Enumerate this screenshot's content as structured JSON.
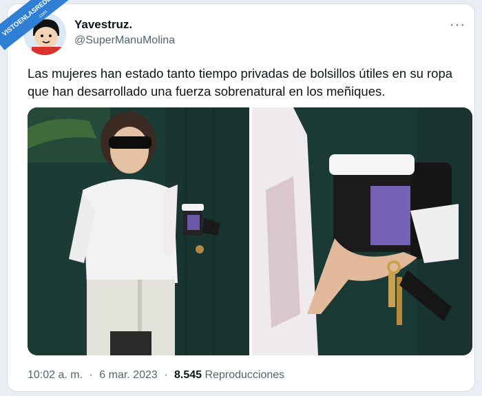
{
  "watermark": {
    "line1": "VISTOENLASREDES",
    "line2": ".com"
  },
  "author": {
    "name": "Yavestruz.",
    "handle": "@SuperManuMolina"
  },
  "menu": {
    "more_label": "···"
  },
  "tweet": {
    "text": "Las mujeres han estado tanto tiempo privadas de bolsillos útiles en su ropa que han desarrollado una fuerza sobrenatural en los meñiques."
  },
  "meta": {
    "time": "10:02 a. m.",
    "separator": "·",
    "date": "6 mar. 2023",
    "views": "8.545",
    "views_label": "Reproducciones"
  },
  "colors": {
    "text": "#0f1419",
    "secondary": "#536471",
    "background": "#e8eef4",
    "ribbon": "#2f7fd4"
  }
}
